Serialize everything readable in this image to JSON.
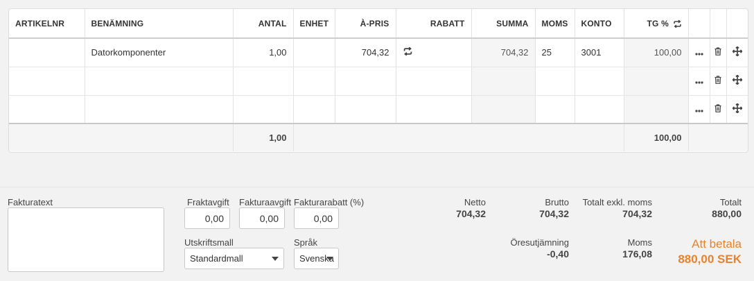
{
  "table": {
    "headers": {
      "artikelnr": "ARTIKELNR",
      "benamning": "BENÄMNING",
      "antal": "ANTAL",
      "enhet": "ENHET",
      "apris": "À-PRIS",
      "rabatt": "RABATT",
      "summa": "SUMMA",
      "moms": "MOMS",
      "konto": "KONTO",
      "tg": "TG %"
    },
    "rows": [
      {
        "artikelnr": "",
        "benamning": "Datorkomponenter",
        "antal": "1,00",
        "enhet": "",
        "apris": "704,32",
        "rabatt": "",
        "summa": "704,32",
        "moms": "25",
        "konto": "3001",
        "tg": "100,00"
      },
      {
        "artikelnr": "",
        "benamning": "",
        "antal": "",
        "enhet": "",
        "apris": "",
        "rabatt": "",
        "summa": "",
        "moms": "",
        "konto": "",
        "tg": ""
      },
      {
        "artikelnr": "",
        "benamning": "",
        "antal": "",
        "enhet": "",
        "apris": "",
        "rabatt": "",
        "summa": "",
        "moms": "",
        "konto": "",
        "tg": ""
      }
    ],
    "totals": {
      "antal": "1,00",
      "tg": "100,00"
    }
  },
  "footer": {
    "fakturatext": {
      "label": "Fakturatext",
      "value": ""
    },
    "fraktavgift": {
      "label": "Fraktavgift",
      "value": "0,00"
    },
    "fakturaavgift": {
      "label": "Fakturaavgift",
      "value": "0,00"
    },
    "fakturarabatt": {
      "label": "Fakturarabatt (%)",
      "value": "0,00"
    },
    "utskriftsmall": {
      "label": "Utskriftsmall",
      "value": "Standardmall"
    },
    "sprak": {
      "label": "Språk",
      "value": "Svenska"
    }
  },
  "summary": {
    "netto": {
      "label": "Netto",
      "value": "704,32"
    },
    "brutto": {
      "label": "Brutto",
      "value": "704,32"
    },
    "exkl_moms": {
      "label": "Totalt exkl. moms",
      "value": "704,32"
    },
    "totalt": {
      "label": "Totalt",
      "value": "880,00"
    },
    "oresutjamning": {
      "label": "Öresutjämning",
      "value": "-0,40"
    },
    "moms": {
      "label": "Moms",
      "value": "176,08"
    },
    "att_betala": {
      "label": "Att betala",
      "value": "880,00 SEK"
    }
  },
  "colors": {
    "accent": "#e8822c",
    "background": "#f2f2f2"
  },
  "icons": {
    "row_menu": "ellipsis-icon",
    "delete": "trash-icon",
    "move": "move-icon",
    "recurring": "repeat-icon"
  }
}
